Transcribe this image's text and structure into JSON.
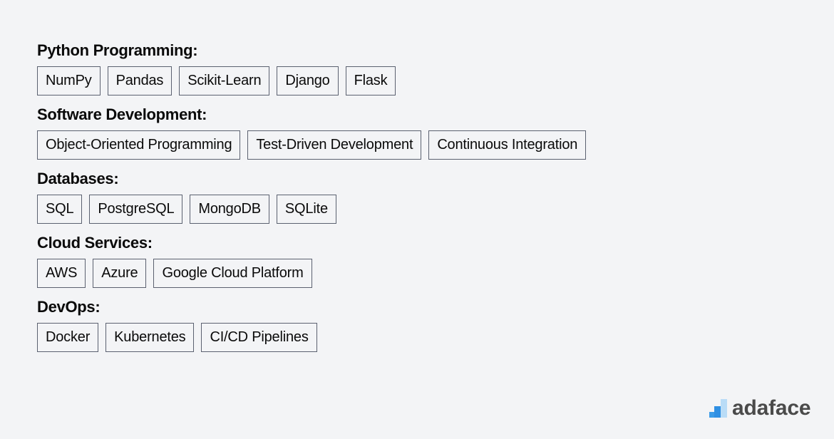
{
  "sections": [
    {
      "title": "Python Programming:",
      "items": [
        "NumPy",
        "Pandas",
        "Scikit-Learn",
        "Django",
        "Flask"
      ]
    },
    {
      "title": "Software Development:",
      "items": [
        "Object-Oriented Programming",
        "Test-Driven Development",
        "Continuous Integration"
      ]
    },
    {
      "title": "Databases:",
      "items": [
        "SQL",
        "PostgreSQL",
        "MongoDB",
        "SQLite"
      ]
    },
    {
      "title": "Cloud Services:",
      "items": [
        "AWS",
        "Azure",
        "Google Cloud Platform"
      ]
    },
    {
      "title": "DevOps:",
      "items": [
        "Docker",
        "Kubernetes",
        "CI/CD Pipelines"
      ]
    }
  ],
  "logo": {
    "text": "adaface",
    "icon": "bar-chart-logo-icon"
  },
  "colors": {
    "background": "#f3f4f6",
    "chip_border": "#5b6170",
    "logo_blue": "#2f8fe3",
    "logo_light_blue": "#b9dcf7",
    "logo_text": "#4a4a4a"
  }
}
